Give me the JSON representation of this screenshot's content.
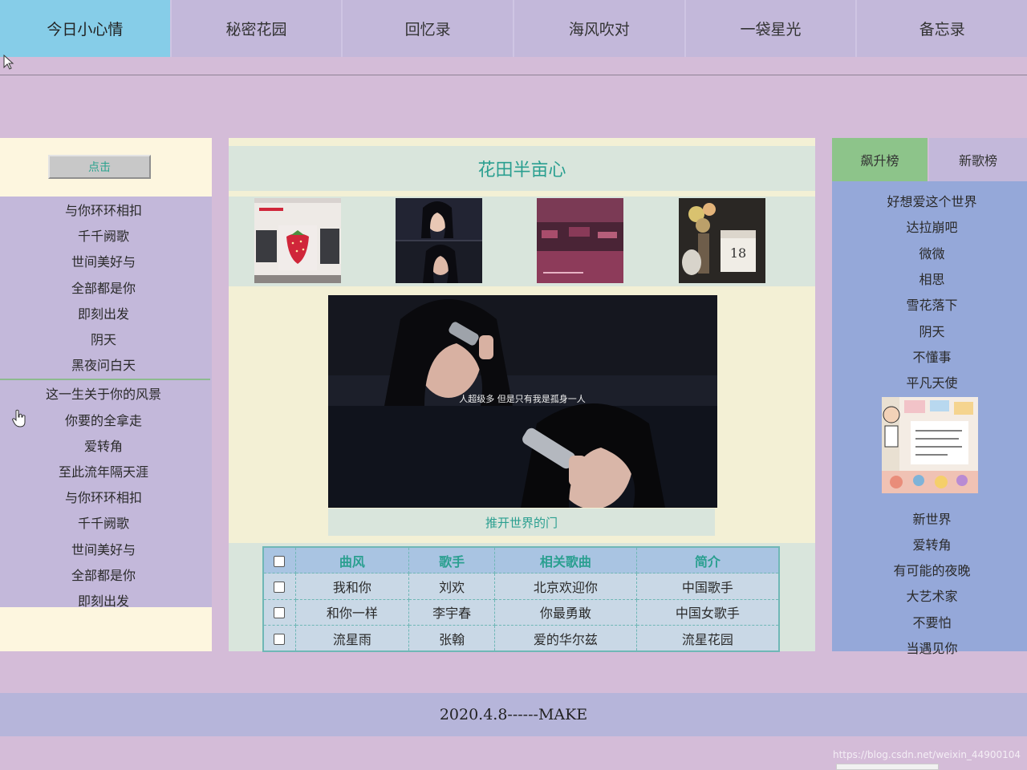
{
  "nav": {
    "tabs": [
      {
        "label": "今日小心情",
        "active": true
      },
      {
        "label": "秘密花园",
        "active": false
      },
      {
        "label": "回忆录",
        "active": false
      },
      {
        "label": "海风吹对",
        "active": false
      },
      {
        "label": "一袋星光",
        "active": false
      },
      {
        "label": "备忘录",
        "active": false
      }
    ],
    "active_color": "#86cde8",
    "bg_color": "#c3b8da"
  },
  "left": {
    "button_label": "点击",
    "items_top": [
      "与你环环相扣",
      "千千阙歌",
      "世间美好与",
      "全部都是你",
      "即刻出发",
      "阴天",
      "黑夜问白天"
    ],
    "items_bottom": [
      "这一生关于你的风景",
      "你要的全拿走",
      "爱转角",
      "至此流年隔天涯",
      "与你环环相扣",
      "千千阙歌",
      "世间美好与",
      "全部都是你",
      "即刻出发"
    ]
  },
  "center": {
    "title": "花田半亩心",
    "hero_subtitle": "人超级多 但是只有我是孤身一人",
    "caption": "推开世界的门",
    "thumb_date": "18",
    "table": {
      "headers": [
        "曲风",
        "歌手",
        "相关歌曲",
        "简介"
      ],
      "rows": [
        [
          "我和你",
          "刘欢",
          "北京欢迎你",
          "中国歌手"
        ],
        [
          "和你一样",
          "李宇春",
          "你最勇敢",
          "中国女歌手"
        ],
        [
          "流星雨",
          "张翰",
          "爱的华尔兹",
          "流星花园"
        ]
      ]
    }
  },
  "right": {
    "tabs": [
      "飙升榜",
      "新歌榜"
    ],
    "items_top": [
      "好想爱这个世界",
      "达拉崩吧",
      "微微",
      "相思",
      "雪花落下",
      "阴天",
      "不懂事",
      "平凡天使"
    ],
    "items_bottom": [
      "新世界",
      "爱转角",
      "有可能的夜晚",
      "大艺术家",
      "不要怕",
      "当遇见你"
    ]
  },
  "footer": {
    "text": "2020.4.8------MAKE"
  },
  "watermark": "https://blog.csdn.net/weixin_44900104",
  "colors": {
    "page_bg": "#d4bcd8",
    "panel_lavender": "#c3b8da",
    "panel_cream": "#fdf6df",
    "right_blue": "#95a8d9",
    "teal_text": "#2a9f90",
    "green_tab": "#8dc48a"
  }
}
